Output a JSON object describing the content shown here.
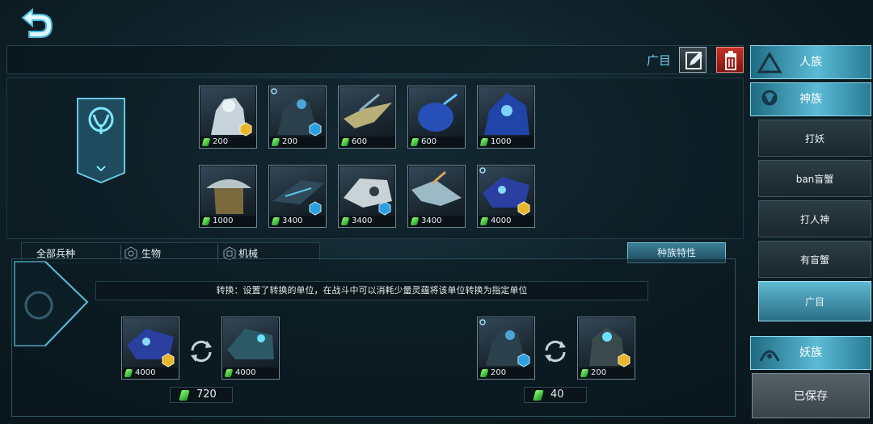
{
  "header": {
    "deck_name": "广目"
  },
  "units_top": [
    {
      "cost": "200",
      "badge": "yellow"
    },
    {
      "cost": "200",
      "badge": "blue"
    },
    {
      "cost": "600",
      "badge": ""
    },
    {
      "cost": "600",
      "badge": ""
    },
    {
      "cost": "1000",
      "badge": ""
    }
  ],
  "units_bottom": [
    {
      "cost": "1000",
      "badge": ""
    },
    {
      "cost": "3400",
      "badge": "blue"
    },
    {
      "cost": "3400",
      "badge": "blue"
    },
    {
      "cost": "3400",
      "badge": ""
    },
    {
      "cost": "4000",
      "badge": "yellow"
    }
  ],
  "filter_tabs": {
    "all": "全部兵种",
    "bio": "生物",
    "mech": "机械",
    "race_trait": "种族特性"
  },
  "description": "转换：设置了转换的单位，在战斗中可以消耗少量灵蕴将该单位转换为指定单位",
  "conversions": [
    {
      "from_cost": "4000",
      "to_cost": "4000",
      "price": "720"
    },
    {
      "from_cost": "200",
      "to_cost": "200",
      "price": "40"
    }
  ],
  "sidebar": {
    "races": [
      "人族",
      "神族",
      "妖族"
    ],
    "decks": [
      "打妖",
      "ban盲蟹",
      "打人神",
      "有盲蟹",
      "广目"
    ],
    "saved_label": "已保存"
  },
  "colors": {
    "accent": "#5bbbd6",
    "gem": "#6fe04a",
    "danger": "#b3261e",
    "badge_yellow": "#e9b62c",
    "badge_blue": "#2b9fe0"
  }
}
